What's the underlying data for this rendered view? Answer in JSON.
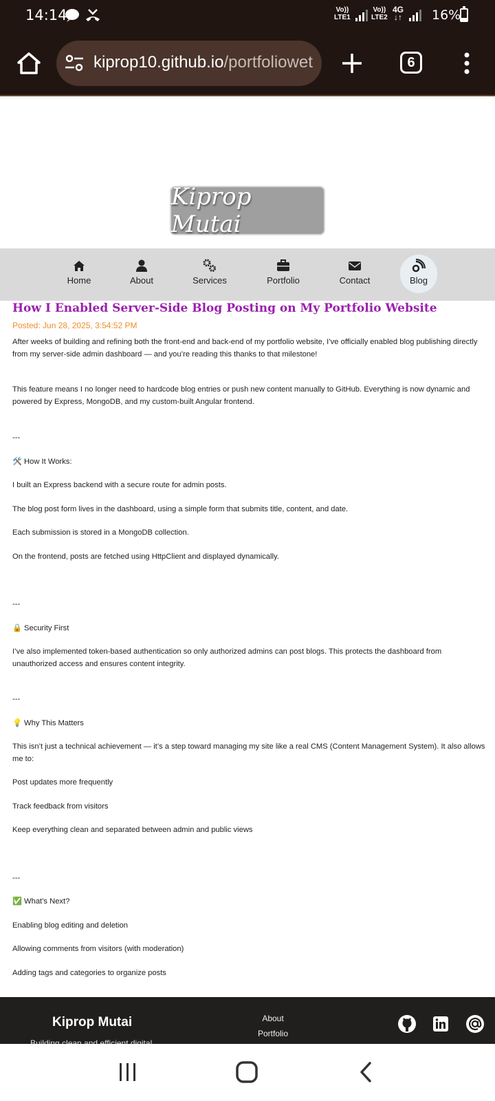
{
  "status_bar": {
    "time": "14:14",
    "sim1_label": "Vo)) LTE1",
    "sim2_label": "Vo)) LTE2",
    "network": "4G",
    "battery": "16%"
  },
  "browser": {
    "url_host": "kiprop10.github.io",
    "url_path": "/portfoliowet",
    "tab_count": "6"
  },
  "site": {
    "logo_text": "Kiprop Mutai",
    "nav": [
      {
        "label": "Home",
        "icon": "home-icon"
      },
      {
        "label": "About",
        "icon": "user-icon"
      },
      {
        "label": "Services",
        "icon": "gears-icon"
      },
      {
        "label": "Portfolio",
        "icon": "briefcase-icon"
      },
      {
        "label": "Contact",
        "icon": "envelope-icon"
      },
      {
        "label": "Blog",
        "icon": "blog-icon",
        "active": true
      }
    ]
  },
  "post": {
    "title": "How I Enabled Server-Side Blog Posting on My Portfolio Website",
    "posted": "Posted: Jun 28, 2025, 3:54:52 PM",
    "p1": "After weeks of building and refining both the front-end and back-end of my portfolio website, I’ve officially enabled blog publishing directly from my server-side admin dashboard — and you’re reading this thanks to that milestone!",
    "p2": "This feature means I no longer need to hardcode blog entries or push new content manually to GitHub. Everything is now dynamic and powered by Express, MongoDB, and my custom-built Angular frontend.",
    "sep1": "---",
    "h_how": "🛠️ How It Works:",
    "how1": "I built an Express backend with a secure route for admin posts.",
    "how2": "The blog post form lives in the dashboard, using a simple form that submits title, content, and date.",
    "how3": "Each submission is stored in a MongoDB collection.",
    "how4": "On the frontend, posts are fetched using HttpClient and displayed dynamically.",
    "sep2": "---",
    "h_sec": "🔒 Security First",
    "sec1": "I’ve also implemented token-based authentication so only authorized admins can post blogs. This protects the dashboard from unauthorized access and ensures content integrity.",
    "sep3": "---",
    "h_why": "💡 Why This Matters",
    "why1": "This isn’t just a technical achievement — it’s a step toward managing my site like a real CMS (Content Management System). It also allows me to:",
    "why2": "Post updates more frequently",
    "why3": "Track feedback from visitors",
    "why4": "Keep everything clean and separated between admin and public views",
    "sep4": "---",
    "h_next": "✅ What’s Next?",
    "next1": "Enabling blog editing and deletion",
    "next2": "Allowing comments from visitors (with moderation)",
    "next3": "Adding tags and categories to organize posts"
  },
  "footer": {
    "brand": "Kiprop Mutai",
    "tagline": "Building clean and efficient digital",
    "link_about": "About",
    "link_portfolio": "Portfolio",
    "social": [
      "github-icon",
      "linkedin-icon",
      "at-icon"
    ]
  },
  "colors": {
    "chrome_bg": "#211512",
    "url_bg": "#4a342c",
    "title_color": "#9b1fae",
    "date_color": "#ef8d2a",
    "nav_bg": "#d9d9d9",
    "footer_bg": "#211f1d"
  }
}
